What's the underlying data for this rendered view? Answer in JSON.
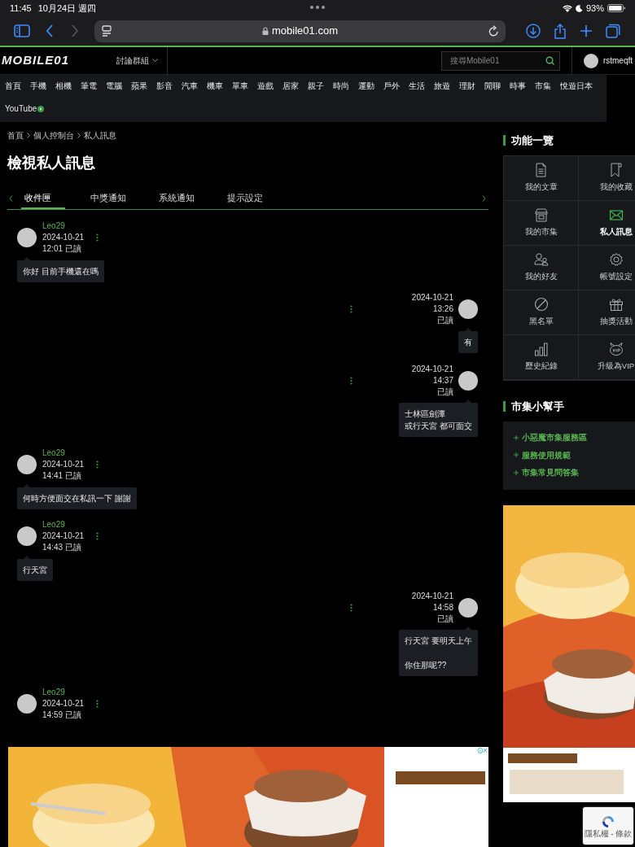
{
  "status_bar": {
    "time": "11:45",
    "date": "10月24日 週四",
    "battery": "93%"
  },
  "browser": {
    "url": "mobile01.com",
    "forward_disabled": true
  },
  "site_header": {
    "logo": "MOBILE01",
    "menu": "討論群組",
    "search_placeholder": "搜尋Mobile01",
    "username": "rstmeqft"
  },
  "nav": {
    "items": [
      "首頁",
      "手機",
      "相機",
      "筆電",
      "電腦",
      "蘋果",
      "影音",
      "汽車",
      "機車",
      "單車",
      "遊戲",
      "居家",
      "親子",
      "時尚",
      "運動",
      "戶外",
      "生活",
      "旅遊",
      "理財",
      "閒聊",
      "時事",
      "市集",
      "悅遊日本",
      "YouTube"
    ]
  },
  "breadcrumb": [
    "首頁",
    "個人控制台",
    "私人訊息"
  ],
  "page_title": "檢視私人訊息",
  "tabs": [
    {
      "label": "收件匣",
      "selected": true
    },
    {
      "label": "中獎通知",
      "selected": false
    },
    {
      "label": "系統通知",
      "selected": false
    },
    {
      "label": "提示設定",
      "selected": false
    }
  ],
  "messages": [
    {
      "kind": "received",
      "sender": "Leo29",
      "date": "2024-10-21",
      "time": "12:01",
      "read": "已讀",
      "text": "你好 目前手機還在嗎"
    },
    {
      "kind": "sent",
      "date": "2024-10-21",
      "time": "13:26",
      "read": "已讀",
      "text": "有"
    },
    {
      "kind": "sent",
      "date": "2024-10-21",
      "time": "14:37",
      "read": "已讀",
      "lines": [
        "士林區劍潭",
        "或行天宮 都可面交"
      ]
    },
    {
      "kind": "received",
      "sender": "Leo29",
      "date": "2024-10-21",
      "time": "14:41",
      "read": "已讀",
      "text": "何時方便面交在私訊一下 謝謝"
    },
    {
      "kind": "received",
      "sender": "Leo29",
      "date": "2024-10-21",
      "time": "14:43",
      "read": "已讀",
      "text": "行天宮"
    },
    {
      "kind": "sent",
      "date": "2024-10-21",
      "time": "14:58",
      "read": "已讀",
      "paragraphs": [
        "行天宮 要明天上午",
        "你住那呢??"
      ]
    },
    {
      "kind": "received",
      "sender": "Leo29",
      "date": "2024-10-21",
      "time": "14:59",
      "read": "已讀"
    }
  ],
  "sidebar": {
    "features_title": "功能一覽",
    "features": [
      {
        "label": "我的文章",
        "kind": "document",
        "selected": false
      },
      {
        "label": "我的收藏",
        "kind": "bookmark",
        "selected": false
      },
      {
        "label": "我的市集",
        "kind": "store",
        "selected": false
      },
      {
        "label": "私人訊息",
        "kind": "envelope",
        "selected": true
      },
      {
        "label": "我的好友",
        "kind": "friends",
        "selected": false
      },
      {
        "label": "帳號設定",
        "kind": "gear",
        "selected": false
      },
      {
        "label": "黑名單",
        "kind": "ban",
        "selected": false
      },
      {
        "label": "抽獎活動",
        "kind": "gift",
        "selected": false
      },
      {
        "label": "歷史紀錄",
        "kind": "bars",
        "selected": false
      },
      {
        "label": "升級為VIP",
        "kind": "vip",
        "selected": false
      }
    ],
    "helper_title": "市集小幫手",
    "helper_links": [
      "小惡魔市集服務區",
      "服務使用規範",
      "市集常見問答集"
    ]
  },
  "recaptcha": {
    "text": "隱私權 - 條款"
  }
}
